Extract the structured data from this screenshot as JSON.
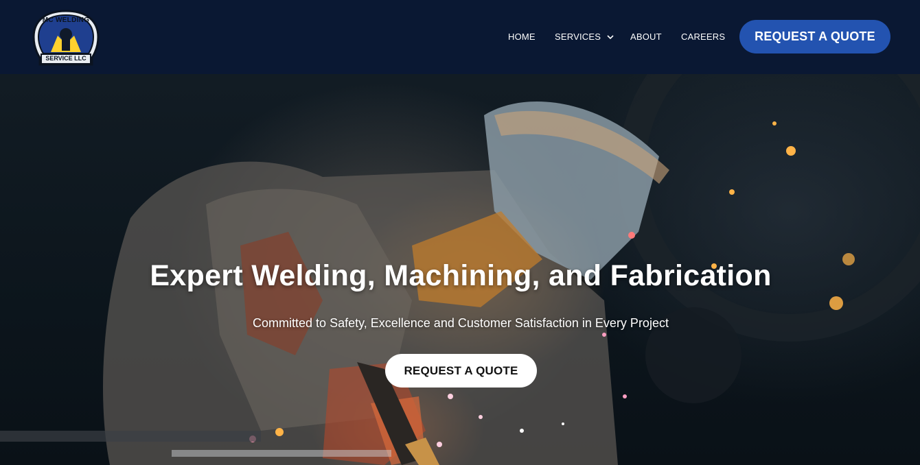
{
  "header": {
    "logo": {
      "top_text": "MC WELDING",
      "bottom_text": "SERVICE LLC"
    },
    "nav": {
      "home": "HOME",
      "services": "SERVICES",
      "about": "ABOUT",
      "careers": "CAREERS"
    },
    "cta_label": "REQUEST A QUOTE"
  },
  "hero": {
    "title": "Expert Welding, Machining, and Fabrication",
    "subtitle": "Committed to Safety, Excellence and Customer Satisfaction in Every Project",
    "cta_label": "REQUEST A QUOTE"
  },
  "colors": {
    "header_bg": "#0a1833",
    "accent_blue": "#2353b0",
    "hero_button_bg": "#ffffff",
    "spark_orange": "#ff8a2a"
  },
  "icons": {
    "services_dropdown": "chevron-down-icon",
    "logo": "welder-logo-icon"
  }
}
